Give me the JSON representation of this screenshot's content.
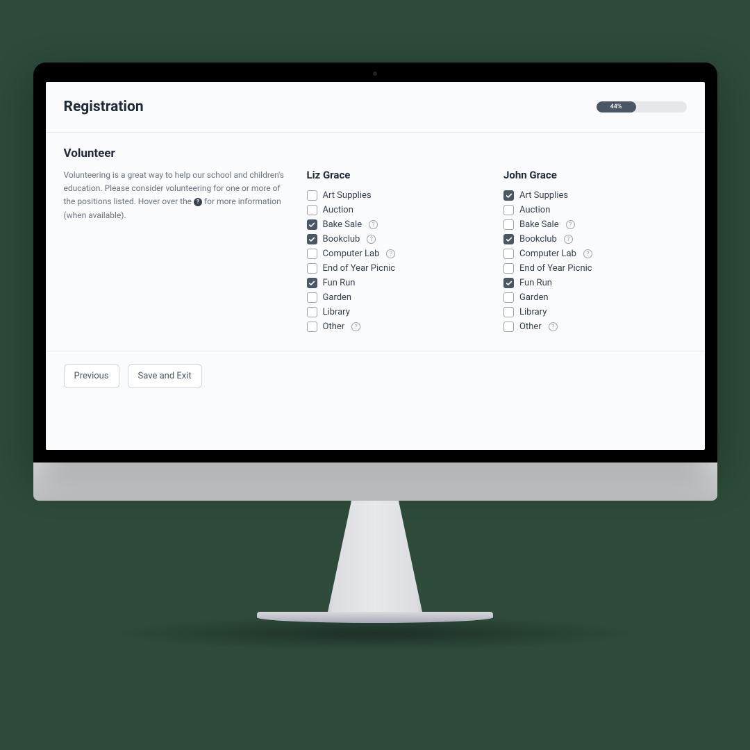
{
  "page_title": "Registration",
  "progress": {
    "percent": 44,
    "label": "44%"
  },
  "section_title": "Volunteer",
  "description": {
    "before": "Volunteering is a great way to help our school and children's education. Please consider volunteering for one or more of the positions listed. Hover over the ",
    "after": " for more information (when available)."
  },
  "positions": [
    {
      "label": "Art Supplies",
      "help": false
    },
    {
      "label": "Auction",
      "help": false
    },
    {
      "label": "Bake Sale",
      "help": true
    },
    {
      "label": "Bookclub",
      "help": true
    },
    {
      "label": "Computer Lab",
      "help": true
    },
    {
      "label": "End of Year Picnic",
      "help": false
    },
    {
      "label": "Fun Run",
      "help": false
    },
    {
      "label": "Garden",
      "help": false
    },
    {
      "label": "Library",
      "help": false
    },
    {
      "label": "Other",
      "help": true
    }
  ],
  "people": [
    {
      "name": "Liz Grace",
      "checked": [
        2,
        3,
        6
      ]
    },
    {
      "name": "John Grace",
      "checked": [
        0,
        3,
        6
      ]
    }
  ],
  "buttons": {
    "previous": "Previous",
    "save_exit": "Save and Exit"
  }
}
